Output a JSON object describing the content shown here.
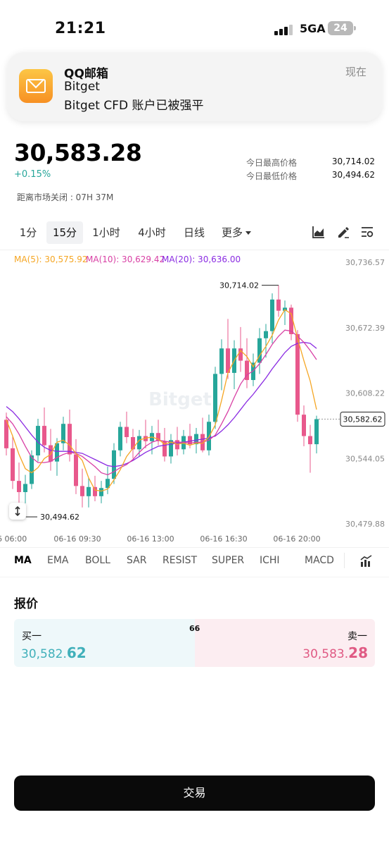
{
  "status_bar": {
    "time": "21:21",
    "network": "5GA",
    "battery": "24"
  },
  "notification": {
    "app": "QQ邮箱",
    "line1": "Bitget",
    "line2": "Bitget CFD 账户已被强平",
    "time": "现在"
  },
  "quote_header": {
    "price": "30,583.28",
    "change": "+0.15%",
    "market_close": "距离市场关闭 : 07H 37M",
    "high_label": "今日最高价格",
    "high_value": "30,714.02",
    "low_label": "今日最低价格",
    "low_value": "30,494.62"
  },
  "intervals": [
    "1分",
    "15分",
    "1小时",
    "4小时",
    "日线",
    "更多"
  ],
  "active_interval": "15分",
  "ma_legend": {
    "ma5": "MA(5): 30,575.92",
    "ma10": "MA(10): 30,629.42",
    "ma20": "MA(20): 30,636.00"
  },
  "colors": {
    "up": "#26a69a",
    "down": "#e8588c",
    "ma5": "#f5a623",
    "ma10": "#d83fa4",
    "ma20": "#8a2be2",
    "bid_bg": "#eef8fa",
    "ask_bg": "#fcedf1"
  },
  "chart_data": {
    "type": "candlestick",
    "ylim": [
      30479.88,
      30736.57
    ],
    "y_ticks": [
      "30,736.57",
      "30,672.39",
      "30,608.22",
      "30,544.05",
      "30,479.88"
    ],
    "x_ticks": [
      "6 06:00",
      "06-16 09:30",
      "06-16 13:00",
      "06-16 16:30",
      "06-16 20:00"
    ],
    "watermark": "Bitget",
    "high_annotation": "30,714.02",
    "low_annotation": "30,494.62",
    "current_price": "30,582.62",
    "candles": [
      {
        "o": 30582,
        "h": 30589,
        "l": 30547,
        "c": 30554
      },
      {
        "o": 30554,
        "h": 30566,
        "l": 30514,
        "c": 30522
      },
      {
        "o": 30522,
        "h": 30540,
        "l": 30495,
        "c": 30511
      },
      {
        "o": 30511,
        "h": 30528,
        "l": 30500,
        "c": 30519
      },
      {
        "o": 30519,
        "h": 30552,
        "l": 30514,
        "c": 30547
      },
      {
        "o": 30547,
        "h": 30583,
        "l": 30541,
        "c": 30576
      },
      {
        "o": 30576,
        "h": 30594,
        "l": 30550,
        "c": 30557
      },
      {
        "o": 30557,
        "h": 30573,
        "l": 30532,
        "c": 30541
      },
      {
        "o": 30541,
        "h": 30564,
        "l": 30527,
        "c": 30559
      },
      {
        "o": 30559,
        "h": 30585,
        "l": 30552,
        "c": 30578
      },
      {
        "o": 30578,
        "h": 30592,
        "l": 30541,
        "c": 30548
      },
      {
        "o": 30548,
        "h": 30563,
        "l": 30509,
        "c": 30517
      },
      {
        "o": 30517,
        "h": 30534,
        "l": 30496,
        "c": 30507
      },
      {
        "o": 30507,
        "h": 30525,
        "l": 30496,
        "c": 30516
      },
      {
        "o": 30516,
        "h": 30527,
        "l": 30502,
        "c": 30507
      },
      {
        "o": 30507,
        "h": 30522,
        "l": 30500,
        "c": 30515
      },
      {
        "o": 30515,
        "h": 30536,
        "l": 30509,
        "c": 30524
      },
      {
        "o": 30524,
        "h": 30559,
        "l": 30519,
        "c": 30552
      },
      {
        "o": 30552,
        "h": 30580,
        "l": 30546,
        "c": 30575
      },
      {
        "o": 30575,
        "h": 30590,
        "l": 30559,
        "c": 30565
      },
      {
        "o": 30565,
        "h": 30573,
        "l": 30544,
        "c": 30553
      },
      {
        "o": 30553,
        "h": 30572,
        "l": 30546,
        "c": 30566
      },
      {
        "o": 30566,
        "h": 30582,
        "l": 30554,
        "c": 30561
      },
      {
        "o": 30561,
        "h": 30576,
        "l": 30548,
        "c": 30569
      },
      {
        "o": 30569,
        "h": 30582,
        "l": 30557,
        "c": 30561
      },
      {
        "o": 30561,
        "h": 30574,
        "l": 30541,
        "c": 30546
      },
      {
        "o": 30546,
        "h": 30568,
        "l": 30539,
        "c": 30562
      },
      {
        "o": 30562,
        "h": 30575,
        "l": 30547,
        "c": 30553
      },
      {
        "o": 30553,
        "h": 30572,
        "l": 30548,
        "c": 30566
      },
      {
        "o": 30566,
        "h": 30578,
        "l": 30554,
        "c": 30558
      },
      {
        "o": 30558,
        "h": 30574,
        "l": 30549,
        "c": 30568
      },
      {
        "o": 30568,
        "h": 30584,
        "l": 30550,
        "c": 30552
      },
      {
        "o": 30552,
        "h": 30587,
        "l": 30547,
        "c": 30580
      },
      {
        "o": 30580,
        "h": 30634,
        "l": 30573,
        "c": 30627
      },
      {
        "o": 30627,
        "h": 30661,
        "l": 30611,
        "c": 30652
      },
      {
        "o": 30652,
        "h": 30681,
        "l": 30622,
        "c": 30628
      },
      {
        "o": 30628,
        "h": 30660,
        "l": 30612,
        "c": 30652
      },
      {
        "o": 30652,
        "h": 30673,
        "l": 30629,
        "c": 30640
      },
      {
        "o": 30640,
        "h": 30662,
        "l": 30613,
        "c": 30621
      },
      {
        "o": 30621,
        "h": 30647,
        "l": 30615,
        "c": 30638
      },
      {
        "o": 30638,
        "h": 30672,
        "l": 30627,
        "c": 30662
      },
      {
        "o": 30662,
        "h": 30676,
        "l": 30643,
        "c": 30669
      },
      {
        "o": 30669,
        "h": 30706,
        "l": 30657,
        "c": 30700
      },
      {
        "o": 30700,
        "h": 30714,
        "l": 30683,
        "c": 30689
      },
      {
        "o": 30689,
        "h": 30699,
        "l": 30675,
        "c": 30692
      },
      {
        "o": 30692,
        "h": 30695,
        "l": 30660,
        "c": 30666
      },
      {
        "o": 30666,
        "h": 30670,
        "l": 30580,
        "c": 30587
      },
      {
        "o": 30587,
        "h": 30596,
        "l": 30556,
        "c": 30566
      },
      {
        "o": 30566,
        "h": 30577,
        "l": 30530,
        "c": 30558
      },
      {
        "o": 30558,
        "h": 30586,
        "l": 30549,
        "c": 30582.62
      }
    ],
    "ma5": [
      30582,
      30566,
      30548,
      30534,
      30530,
      30535,
      30544,
      30548,
      30560,
      30562,
      30557,
      30549,
      30542,
      30525,
      30513,
      30512,
      30514,
      30523,
      30533,
      30546,
      30554,
      30562,
      30564,
      30565,
      30563,
      30558,
      30560,
      30558,
      30559,
      30557,
      30559,
      30559,
      30565,
      30577,
      30601,
      30628,
      30640,
      30650,
      30644,
      30634,
      30645,
      30654,
      30665,
      30680,
      30690,
      30686,
      30662,
      30640,
      30620,
      30592
    ],
    "ma10": [
      30585,
      30578,
      30568,
      30556,
      30545,
      30540,
      30540,
      30541,
      30545,
      30548,
      30550,
      30549,
      30546,
      30541,
      30536,
      30530,
      30528,
      30531,
      30535,
      30538,
      30543,
      30550,
      30556,
      30560,
      30562,
      30561,
      30560,
      30560,
      30560,
      30559,
      30560,
      30560,
      30562,
      30567,
      30578,
      30590,
      30604,
      30617,
      30626,
      30630,
      30637,
      30646,
      30656,
      30664,
      30670,
      30669,
      30664,
      30658,
      30650,
      30641
    ],
    "ma20": [
      30595,
      30590,
      30583,
      30575,
      30567,
      30560,
      30555,
      30552,
      30551,
      30551,
      30551,
      30550,
      30549,
      30546,
      30543,
      30540,
      30537,
      30536,
      30537,
      30539,
      30542,
      30546,
      30550,
      30553,
      30556,
      30557,
      30558,
      30559,
      30560,
      30561,
      30562,
      30563,
      30564,
      30566,
      30571,
      30577,
      30584,
      30592,
      30600,
      30607,
      30615,
      30623,
      30632,
      30640,
      30648,
      30654,
      30657,
      30658,
      30657,
      30652
    ]
  },
  "indicators": [
    "MA",
    "EMA",
    "BOLL",
    "SAR",
    "RESIST",
    "SUPER",
    "ICHI",
    "MACD"
  ],
  "active_indicator": "MA",
  "quote": {
    "title": "报价",
    "bid_label": "买一",
    "bid_main": "30,582.",
    "bid_decimal": "62",
    "ask_label": "卖一",
    "ask_main": "30,583.",
    "ask_decimal": "28",
    "spread": "66"
  },
  "trade_button": "交易",
  "icons": [
    "qq-mail-icon",
    "area-chart-icon",
    "draw-tool-icon",
    "chart-settings-icon",
    "vertical-resize-icon",
    "indicator-chart-icon"
  ]
}
